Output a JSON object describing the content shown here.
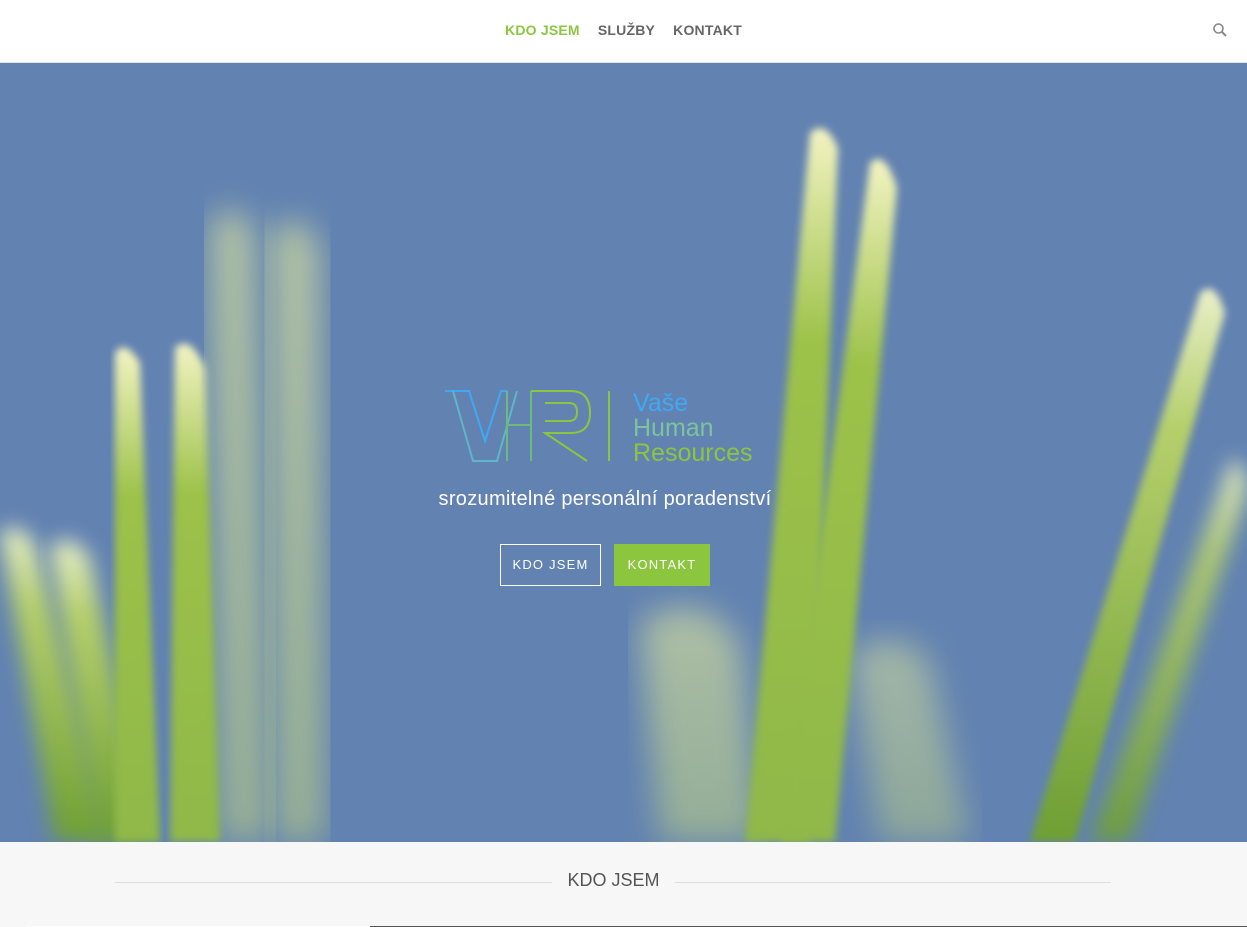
{
  "nav": {
    "items": [
      {
        "label": "KDO JSEM",
        "active": true
      },
      {
        "label": "SLUŽBY",
        "active": false
      },
      {
        "label": "KONTAKT",
        "active": false
      }
    ],
    "search_icon": "search-icon"
  },
  "hero": {
    "logo_mark": "VHR",
    "logo_line1": "Vaše",
    "logo_line2": "Human",
    "logo_line3": "Resources",
    "tagline": "srozumitelné personální poradenství",
    "btn_primary": "KDO JSEM",
    "btn_secondary": "KONTAKT"
  },
  "section": {
    "title": "KDO JSEM"
  },
  "colors": {
    "accent": "#8cc63f",
    "hero_bg": "#6282b1",
    "logo_cyan": "#3fa9f5",
    "logo_green": "#8cc63f"
  }
}
